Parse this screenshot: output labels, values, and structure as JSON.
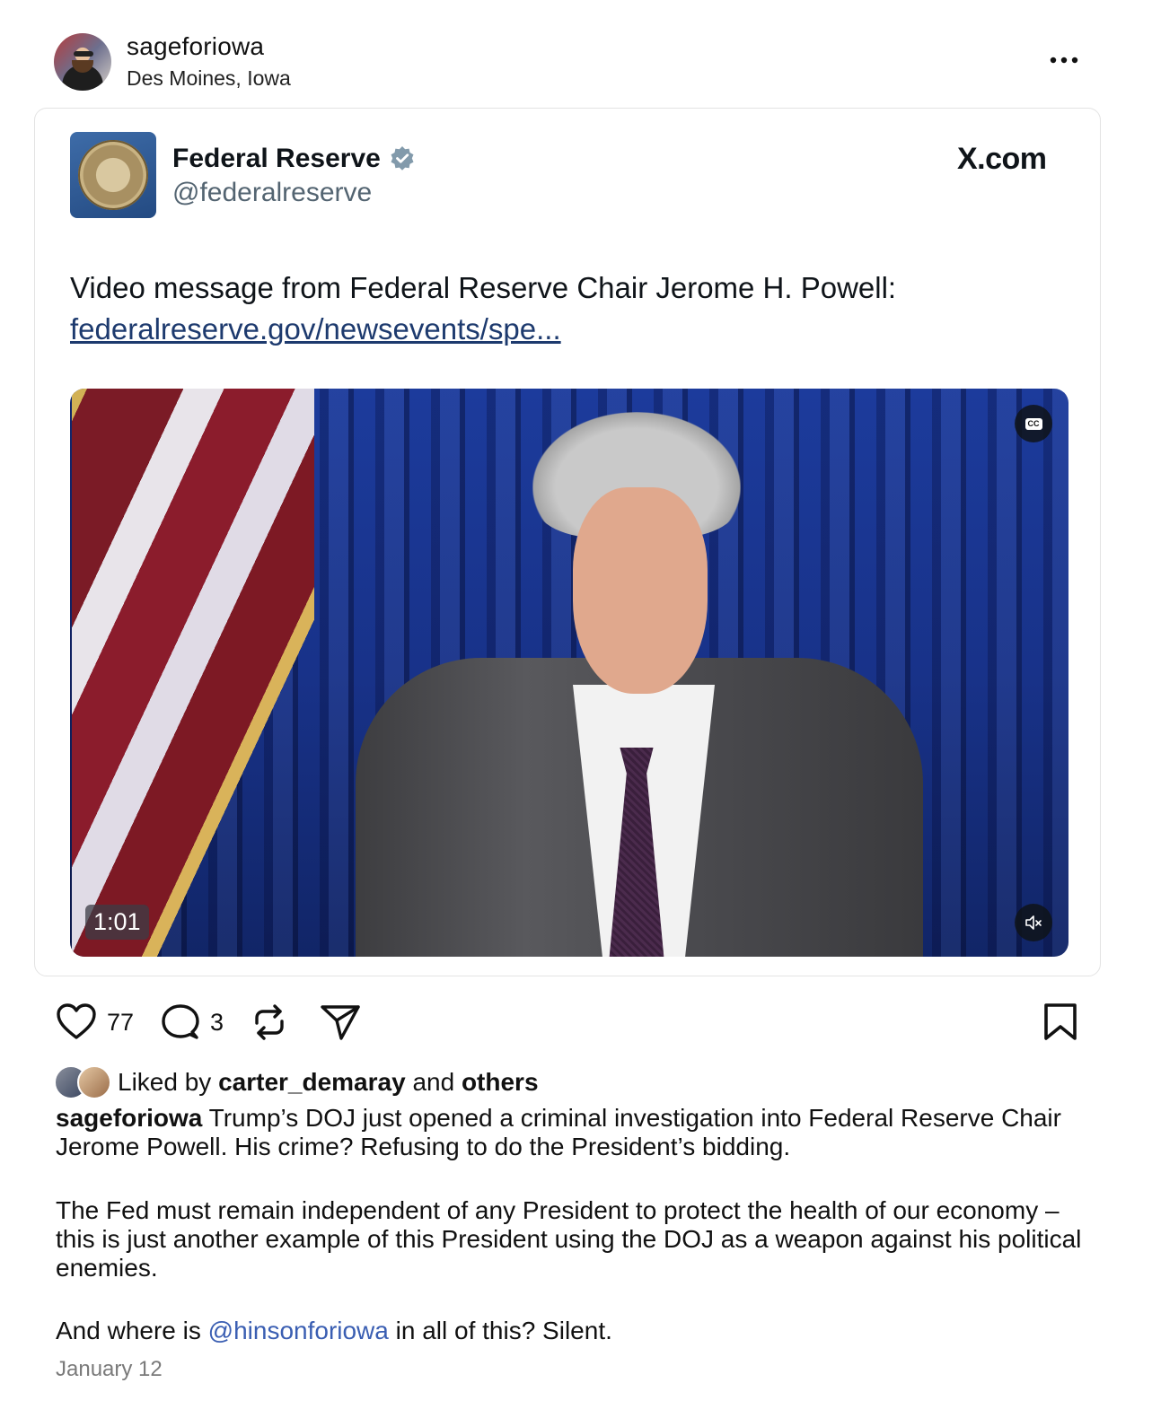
{
  "post": {
    "username": "sageforiowa",
    "location": "Des Moines, Iowa",
    "menu_icon": "more-horizontal-icon"
  },
  "embed": {
    "account_name": "Federal Reserve",
    "handle": "@federalreserve",
    "source": "X.com",
    "text": "Video message from Federal Reserve Chair Jerome H. Powell:",
    "link": "federalreserve.gov/newsevents/spe...",
    "video": {
      "duration": "1:01",
      "cc_label": "CC",
      "muted": true
    }
  },
  "actions": {
    "likes": "77",
    "comments": "3"
  },
  "liked_by": {
    "prefix": "Liked by",
    "user": "carter_demaray",
    "and": "and",
    "others": "others"
  },
  "caption": {
    "username": "sageforiowa",
    "para1": "Trump’s DOJ just opened a criminal investigation into Federal Reserve Chair Jerome Powell. His crime? Refusing to do the President’s bidding.",
    "para2": "The Fed must remain independent of any President to protect the health of our economy – this is just another example of this President using the DOJ as a weapon against his political enemies.",
    "para3_before": "And where is",
    "mention": "@hinsonforiowa",
    "para3_after": "in all of this? Silent."
  },
  "date": "January 12",
  "colors": {
    "mention": "#3a5eb2",
    "verified_badge": "#829aab",
    "link": "#1d3a6e"
  }
}
